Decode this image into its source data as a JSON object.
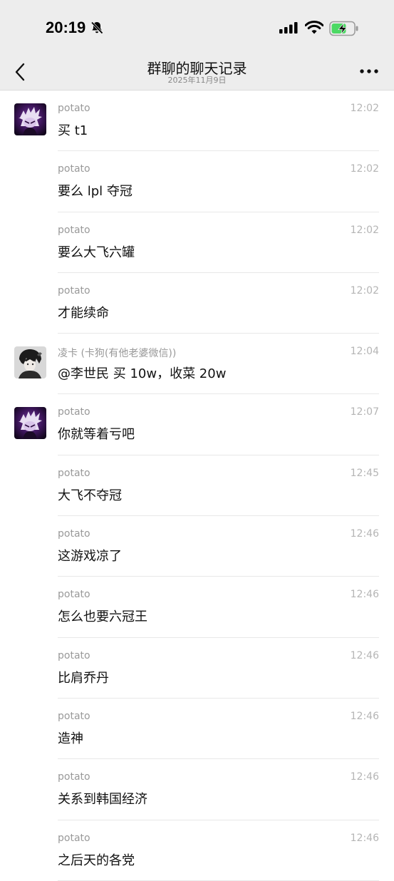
{
  "status": {
    "time": "20:19"
  },
  "nav": {
    "title": "群聊的聊天记录",
    "subtitle": "2025年11月9日"
  },
  "messages": [
    {
      "sender": "potato",
      "time": "12:02",
      "text": "买 t1",
      "avatar": "potato"
    },
    {
      "sender": "potato",
      "time": "12:02",
      "text": "要么 lpl 夺冠",
      "avatar": ""
    },
    {
      "sender": "potato",
      "time": "12:02",
      "text": "要么大飞六罐",
      "avatar": ""
    },
    {
      "sender": "potato",
      "time": "12:02",
      "text": "才能续命",
      "avatar": ""
    },
    {
      "sender": "凌卡 (卡狗(有他老婆微信))",
      "time": "12:04",
      "text": "@李世民 买 10w，收菜 20w",
      "avatar": "lingka"
    },
    {
      "sender": "potato",
      "time": "12:07",
      "text": "你就等着亏吧",
      "avatar": "potato"
    },
    {
      "sender": "potato",
      "time": "12:45",
      "text": "大飞不夺冠",
      "avatar": ""
    },
    {
      "sender": "potato",
      "time": "12:46",
      "text": "这游戏凉了",
      "avatar": ""
    },
    {
      "sender": "potato",
      "time": "12:46",
      "text": "怎么也要六冠王",
      "avatar": ""
    },
    {
      "sender": "potato",
      "time": "12:46",
      "text": "比肩乔丹",
      "avatar": ""
    },
    {
      "sender": "potato",
      "time": "12:46",
      "text": "造神",
      "avatar": ""
    },
    {
      "sender": "potato",
      "time": "12:46",
      "text": "关系到韩国经济",
      "avatar": ""
    },
    {
      "sender": "potato",
      "time": "12:46",
      "text": "之后天的各党",
      "avatar": ""
    }
  ]
}
